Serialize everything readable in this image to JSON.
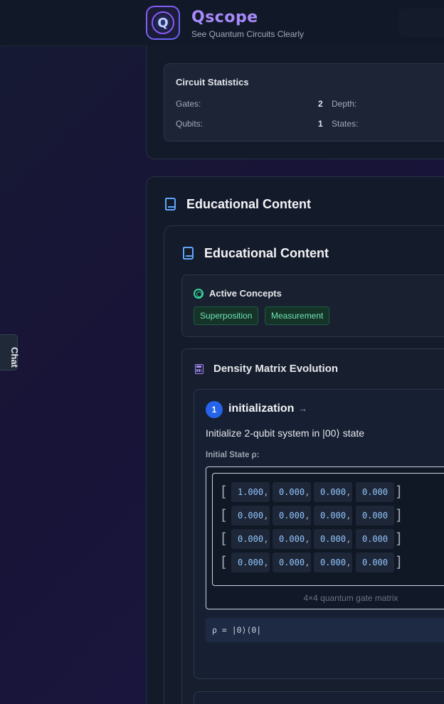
{
  "header": {
    "logo_letter": "Q",
    "app_title": "Qscope",
    "tagline": "See Quantum Circuits Clearly"
  },
  "circuit_statistics": {
    "title": "Circuit Statistics",
    "gates_label": "Gates:",
    "gates_value": "2",
    "depth_label": "Depth:",
    "qubits_label": "Qubits:",
    "qubits_value": "1",
    "states_label": "States:"
  },
  "educational_content": {
    "outer_title": "Educational Content",
    "inner_title": "Educational Content",
    "active_concepts": {
      "title": "Active Concepts",
      "tags": [
        "Superposition",
        "Measurement"
      ]
    },
    "density_matrix": {
      "title": "Density Matrix Evolution",
      "step": {
        "number": "1",
        "title": "initialization",
        "arrow": "→",
        "description": "Initialize 2-qubit system in |00⟩ state",
        "initial_state_label": "Initial State ρ:",
        "matrix": [
          [
            "1.000",
            "0.000",
            "0.000",
            "0.000"
          ],
          [
            "0.000",
            "0.000",
            "0.000",
            "0.000"
          ],
          [
            "0.000",
            "0.000",
            "0.000",
            "0.000"
          ],
          [
            "0.000",
            "0.000",
            "0.000",
            "0.000"
          ]
        ],
        "matrix_caption": "4×4 quantum gate matrix",
        "formula": "ρ = |0⟩⟨0|"
      }
    }
  },
  "chat_tab": {
    "label": "Chat"
  },
  "icons": {
    "book": "book-icon",
    "target": "target-icon",
    "calculator": "calculator-icon",
    "arrow": "arrow-right-icon"
  },
  "colors": {
    "accent_purple": "#a78bfa",
    "accent_blue": "#2563eb",
    "concept_green": "#6ee7b7",
    "matrix_value": "#93c5fd"
  }
}
